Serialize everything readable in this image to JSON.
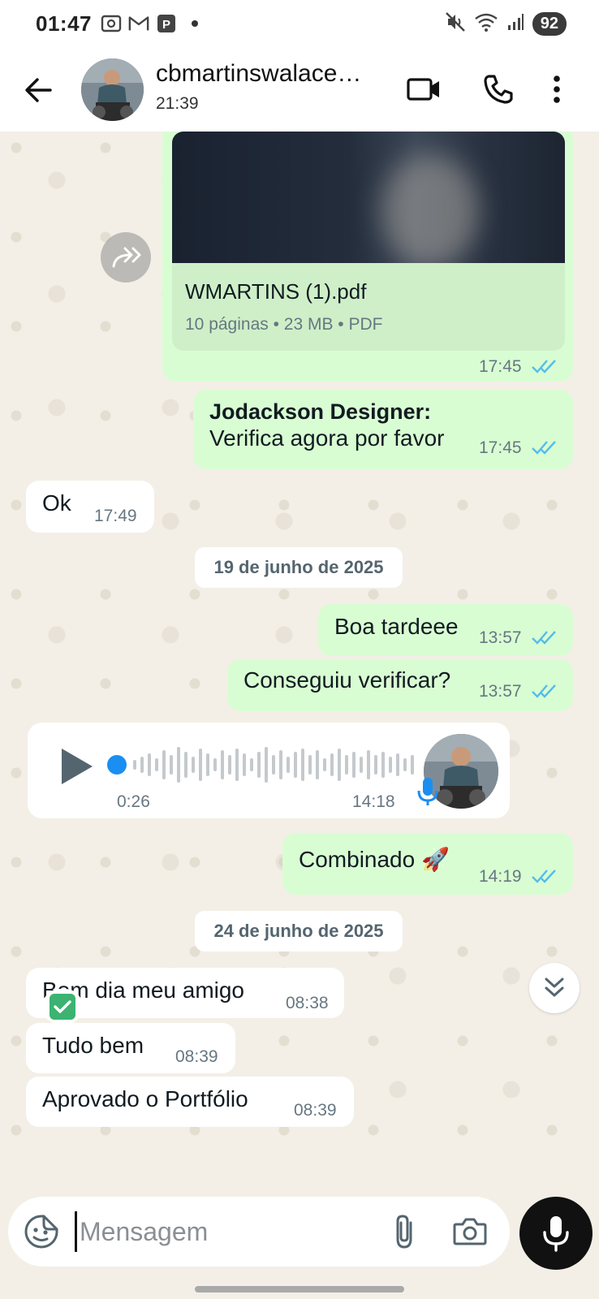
{
  "status_bar": {
    "time": "01:47",
    "battery": "92"
  },
  "header": {
    "contact_name": "cbmartinswalace…",
    "last_seen": "21:39"
  },
  "messages": {
    "document": {
      "file_name": "WMARTINS (1).pdf",
      "meta": "10 páginas • 23 MB • PDF",
      "time": "17:45"
    },
    "forwarded": {
      "sender": "Jodackson Designer:",
      "text": "Verifica agora por favor",
      "time": "17:45"
    },
    "ok": {
      "text": "Ok",
      "time": "17:49"
    },
    "date1": "19 de junho de 2025",
    "boa_tarde": {
      "text": "Boa tardeee",
      "time": "13:57"
    },
    "conseguiu": {
      "text": "Conseguiu verificar?",
      "time": "13:57"
    },
    "voice": {
      "duration": "0:26",
      "time": "14:18"
    },
    "combinado": {
      "text": "Combinado 🚀",
      "time": "14:19"
    },
    "date2": "24 de junho de 2025",
    "bom_dia": {
      "text": "Bom dia meu amigo",
      "time": "08:38"
    },
    "tudo_bem": {
      "text": "Tudo bem",
      "time": "08:39"
    },
    "aprovado": {
      "text": "Aprovado o Portfólio",
      "time": "08:39"
    }
  },
  "input": {
    "placeholder": "Mensagem"
  },
  "colors": {
    "outgoing_bubble": "#d9fdd3",
    "incoming_bubble": "#ffffff",
    "read_ticks": "#53bdeb",
    "chat_bg": "#f3efe7"
  }
}
